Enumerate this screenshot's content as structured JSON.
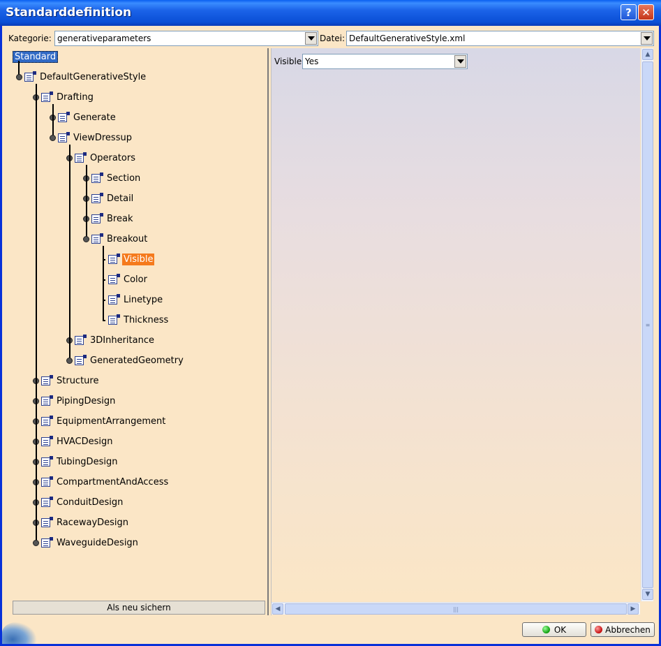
{
  "window": {
    "title": "Standarddefinition"
  },
  "toolbar": {
    "category_label": "Kategorie:",
    "category_value": "generativeparameters",
    "file_label": "Datei:",
    "file_value": "DefaultGenerativeStyle.xml"
  },
  "tree": {
    "root": "Standard",
    "nodes": [
      "DefaultGenerativeStyle",
      "Drafting",
      "Generate",
      "ViewDressup",
      "Operators",
      "Section",
      "Detail",
      "Break",
      "Breakout",
      "Visible",
      "Color",
      "Linetype",
      "Thickness",
      "3DInheritance",
      "GeneratedGeometry",
      "Structure",
      "PipingDesign",
      "EquipmentArrangement",
      "HVACDesign",
      "TubingDesign",
      "CompartmentAndAccess",
      "ConduitDesign",
      "RacewayDesign",
      "WaveguideDesign"
    ],
    "selected": "Visible"
  },
  "left": {
    "save_as_label": "Als neu sichern"
  },
  "detail": {
    "field_label": "Visible",
    "field_value": "Yes"
  },
  "buttons": {
    "ok_label": "OK",
    "cancel_label": "Abbrechen"
  }
}
